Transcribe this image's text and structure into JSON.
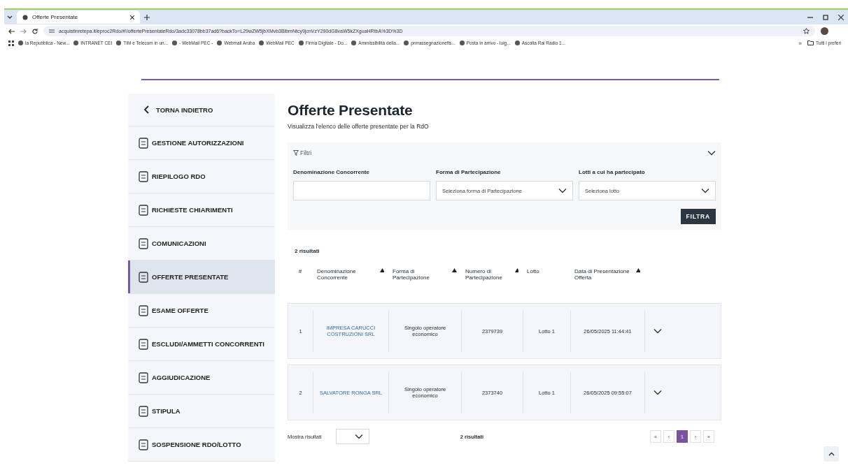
{
  "browser": {
    "tab_title": "Offerte Presentate",
    "url": "acquistinretepa.it/eproc2Rdo/#!/offertePresentateRdo/3adc33078bb37ad6?backTo=L29wZW5jbXMvb3BlbmNtcy9jcnVzY290dG8vaW5kZXguaHRtbA%3D%3D",
    "bookmarks": [
      {
        "label": "la Repubblica - New..."
      },
      {
        "label": "INTRANET CEI"
      },
      {
        "label": "TIM e Telecom in un..."
      },
      {
        "label": "- WebMail PEC -"
      },
      {
        "label": "Webmail Aruba"
      },
      {
        "label": "WebMail PEC"
      },
      {
        "label": "Firma Digitale - Do..."
      },
      {
        "label": "Ammissibilità della..."
      },
      {
        "label": "pnrrassegnazionefis..."
      },
      {
        "label": "Posta in arrivo - luig..."
      },
      {
        "label": "Ascolta Rai Radio 1..."
      }
    ],
    "more": "»",
    "all_bookmarks": "Tutti i preferi"
  },
  "sidebar": {
    "back": "TORNA INDIETRO",
    "items": [
      {
        "label": "GESTIONE AUTORIZZAZIONI",
        "selected": false
      },
      {
        "label": "RIEPILOGO RDO",
        "selected": false
      },
      {
        "label": "RICHIESTE CHIARIMENTI",
        "selected": false
      },
      {
        "label": "COMUNICAZIONI",
        "selected": false
      },
      {
        "label": "OFFERTE PRESENTATE",
        "selected": true
      },
      {
        "label": "ESAME OFFERTE",
        "selected": false
      },
      {
        "label": "ESCLUDI/AMMETTI CONCORRENTI",
        "selected": false
      },
      {
        "label": "AGGIUDICAZIONE",
        "selected": false
      },
      {
        "label": "STIPULA",
        "selected": false
      },
      {
        "label": "SOSPENSIONE RDO/LOTTO",
        "selected": false
      }
    ]
  },
  "page": {
    "title": "Offerte Presentate",
    "subtitle": "Visualizza l'elenco delle offerte presentate per la RdO",
    "filters": {
      "label": "Filtri",
      "expanded": true,
      "fields": [
        {
          "kind": "text",
          "label": "Denominazione Concorrente"
        },
        {
          "kind": "select",
          "label": "Forma di Partecipazione",
          "placeholder": "Seleziona forma di Partecipazione"
        },
        {
          "kind": "select",
          "label": "Lotti a cui ha partecipato",
          "placeholder": "Seleziona lotto"
        }
      ],
      "button": "FILTRA"
    },
    "results_count": "2 risultati",
    "table": {
      "columns": [
        {
          "label": "#",
          "sortable": false
        },
        {
          "label": "Denominazione Concorrente",
          "sortable": true
        },
        {
          "label": "Forma di Partecipazione",
          "sortable": true
        },
        {
          "label": "Numero di Partecipazione",
          "sortable": true
        },
        {
          "label": "Lotto",
          "sortable": false
        },
        {
          "label": "Data di Presentazione Offerta",
          "sortable": true
        }
      ],
      "rows": [
        {
          "cells": [
            "1",
            "IMPRESA CARUCCI COSTRUZIONI SRL",
            "Singolo operatore economico",
            "2379739",
            "Lotto 1",
            "26/05/2025 11:44:41"
          ],
          "expanded": false
        },
        {
          "cells": [
            "2",
            "SALVATORE RONGA SRL",
            "Singolo operatore economico",
            "2373740",
            "Lotto 1",
            "26/05/2025 09:55:07"
          ],
          "expanded": false
        }
      ]
    },
    "footer": {
      "page_size_label": "Mostra risultati",
      "results_count": "2 risultati",
      "pagination": [
        {
          "label": "«",
          "selected": false
        },
        {
          "label": "‹",
          "selected": false
        },
        {
          "label": "1",
          "selected": true
        },
        {
          "label": "›",
          "selected": false
        },
        {
          "label": "»",
          "selected": false
        }
      ]
    }
  }
}
